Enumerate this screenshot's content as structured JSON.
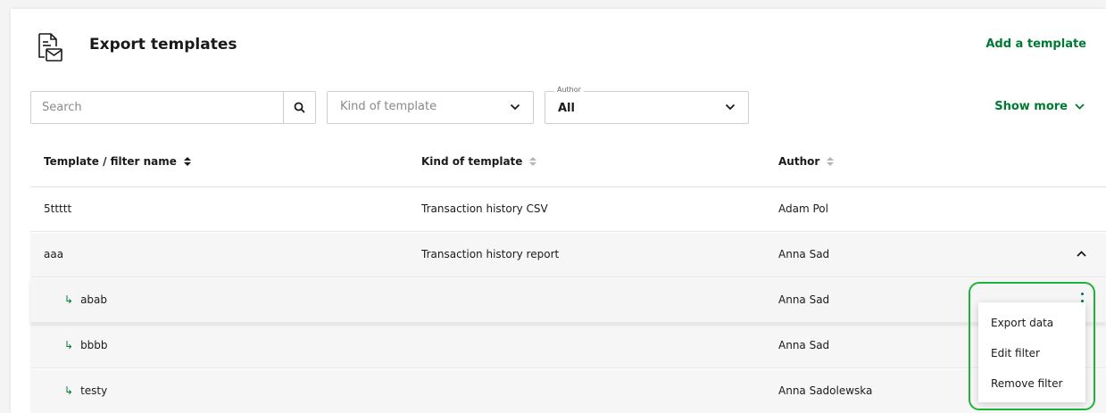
{
  "header": {
    "title": "Export templates",
    "add_link": "Add a template",
    "icon": "export-document-icon"
  },
  "filters": {
    "search_placeholder": "Search",
    "kind_placeholder": "Kind of template",
    "author_label": "Author",
    "author_value": "All",
    "show_more": "Show more"
  },
  "table": {
    "columns": [
      "Template / filter name",
      "Kind of template",
      "Author"
    ],
    "rows": [
      {
        "name": "5ttttt",
        "kind": "Transaction history CSV",
        "author": "Adam Pol"
      },
      {
        "name": "aaa",
        "kind": "Transaction history report",
        "author": "Anna Sad"
      },
      {
        "name": "abab",
        "kind": "",
        "author": "Anna Sad"
      },
      {
        "name": "bbbb",
        "kind": "",
        "author": "Anna Sad"
      },
      {
        "name": "testy",
        "kind": "",
        "author": "Anna Sadolewska"
      }
    ]
  },
  "menu": {
    "items": [
      "Export data",
      "Edit filter",
      "Remove filter"
    ]
  },
  "colors": {
    "accent": "#007a33",
    "highlight_outline": "#1eb339"
  }
}
